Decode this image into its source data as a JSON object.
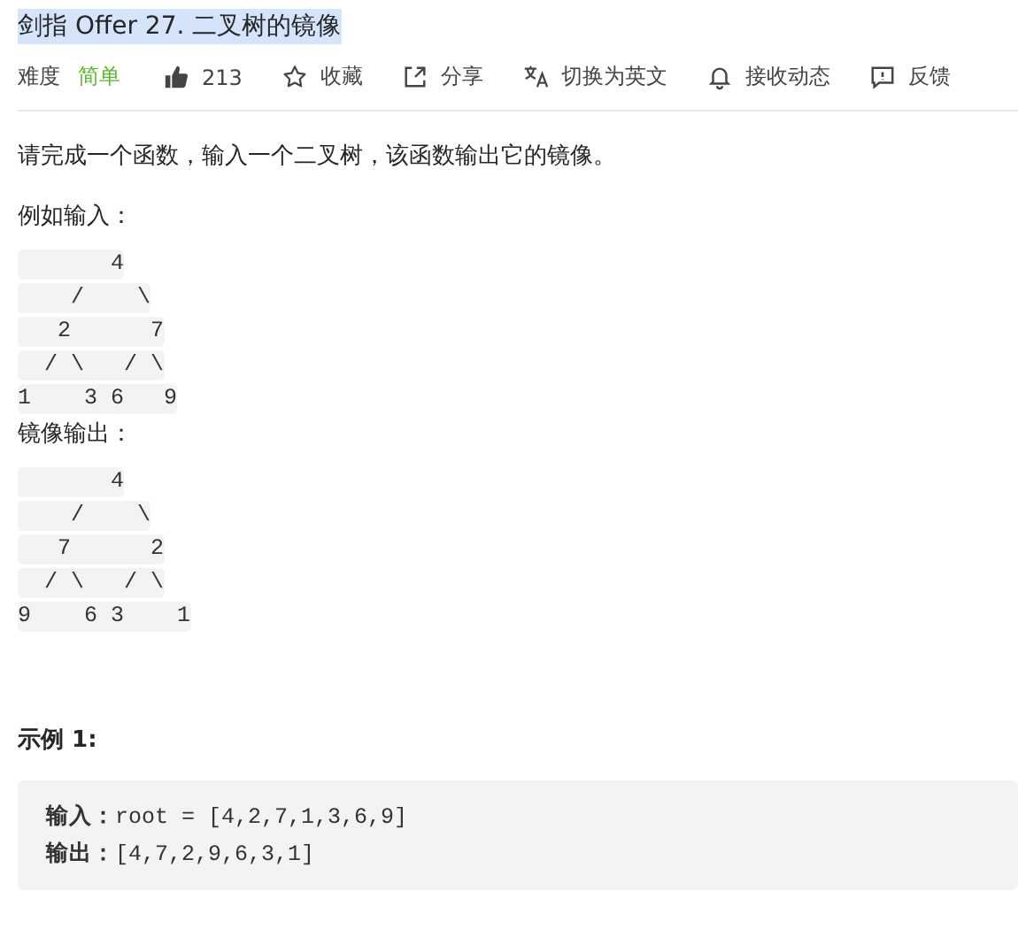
{
  "title": {
    "text": "剑指 Offer 27. 二叉树的镜像",
    "highlighted": true
  },
  "toolbar": {
    "difficulty_label": "难度",
    "difficulty": "简单",
    "likes": "213",
    "actions": [
      {
        "kind": "star",
        "label": "收藏"
      },
      {
        "kind": "share",
        "label": "分享"
      },
      {
        "kind": "translate",
        "label": "切换为英文"
      },
      {
        "kind": "bell",
        "label": "接收动态"
      },
      {
        "kind": "feedback",
        "label": "反馈"
      }
    ]
  },
  "description": "请完成一个函数，输入一个二叉树，该函数输出它的镜像。",
  "input_heading": "例如输入：",
  "input_tree": [
    "       4",
    "    /    \\",
    "   2      7",
    "  / \\   / \\",
    "1    3 6   9"
  ],
  "output_heading": "镜像输出：",
  "output_tree": [
    "       4",
    "    /    \\",
    "   7      2",
    "  / \\   / \\",
    "9    6 3    1"
  ],
  "example": {
    "title": "示例 1:",
    "lines": [
      {
        "label": "输入：",
        "value": "root = [4,2,7,1,3,6,9]"
      },
      {
        "label": "输出：",
        "value": "[4,7,2,9,6,3,1]"
      }
    ]
  }
}
